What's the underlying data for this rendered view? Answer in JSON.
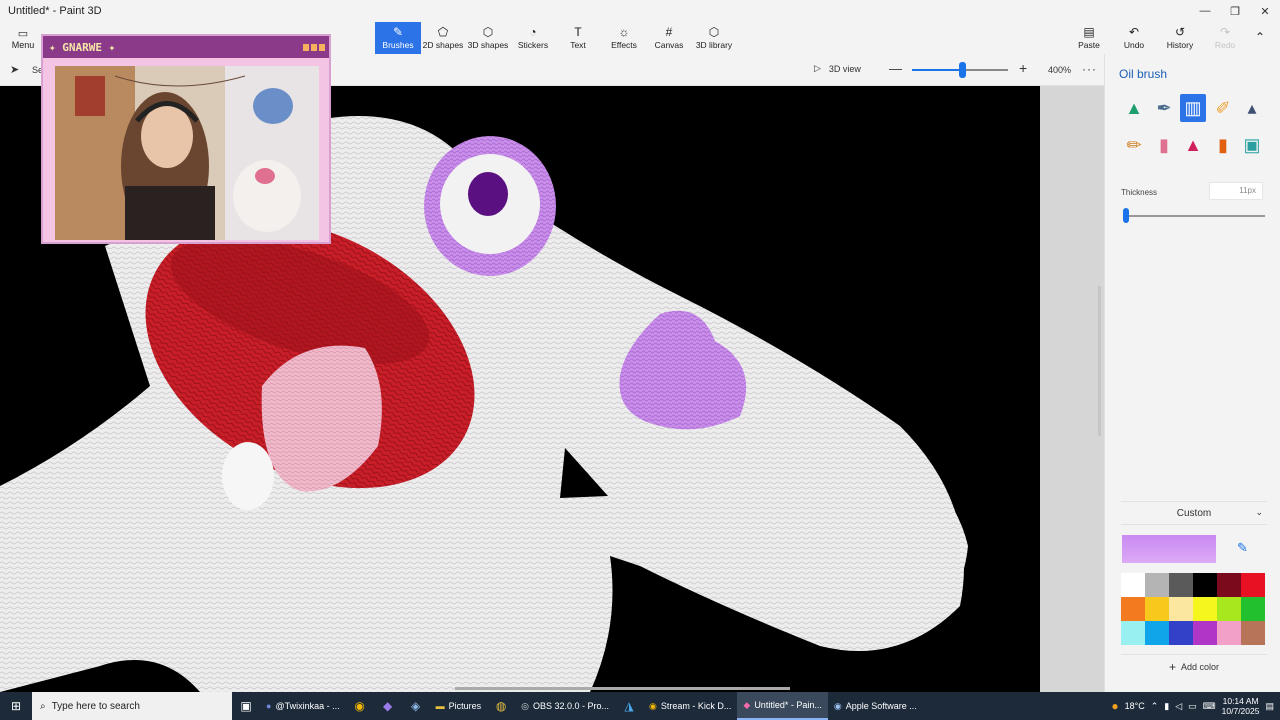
{
  "window": {
    "title": "Untitled* - Paint 3D",
    "minimize_glyph": "—",
    "maximize_glyph": "❐",
    "close_glyph": "✕"
  },
  "ribbon": {
    "menu_label": "Menu",
    "tools": [
      {
        "label": "Brushes",
        "icon": "brush-icon",
        "glyph": "✎",
        "active": true
      },
      {
        "label": "2D shapes",
        "icon": "2d-shapes-icon",
        "glyph": "⬠",
        "active": false
      },
      {
        "label": "3D shapes",
        "icon": "3d-shapes-icon",
        "glyph": "⬡",
        "active": false
      },
      {
        "label": "Stickers",
        "icon": "stickers-icon",
        "glyph": "◔",
        "active": false
      },
      {
        "label": "Text",
        "icon": "text-icon",
        "glyph": "T",
        "active": false
      },
      {
        "label": "Effects",
        "icon": "effects-icon",
        "glyph": "☼",
        "active": false
      },
      {
        "label": "Canvas",
        "icon": "canvas-icon",
        "glyph": "#",
        "active": false
      },
      {
        "label": "3D library",
        "icon": "3d-library-icon",
        "glyph": "⬡",
        "active": false
      }
    ],
    "paste_label": "Paste",
    "undo_label": "Undo",
    "history_label": "History",
    "redo_label": "Redo"
  },
  "subbar": {
    "select_label": "Se",
    "view3d_label": "3D view",
    "zoom_level_percent": 400,
    "zoom_label": "400%",
    "zoom_slider_fraction": 0.52,
    "minus_glyph": "—",
    "plus_glyph": "+",
    "more_glyph": "···"
  },
  "panel": {
    "title": "Oil brush",
    "brushes": [
      {
        "name": "marker-brush-icon",
        "color": "#1f9e6e",
        "selected": false
      },
      {
        "name": "calligraphy-pen-icon",
        "color": "#4a6a8a",
        "selected": false
      },
      {
        "name": "oil-brush-icon",
        "color": "#ffffff",
        "selected": true
      },
      {
        "name": "watercolor-brush-icon",
        "color": "#f0a030",
        "selected": false
      },
      {
        "name": "pixel-pen-icon",
        "color": "#405070",
        "selected": false
      },
      {
        "name": "pencil-icon",
        "color": "#d08020",
        "selected": false
      },
      {
        "name": "eraser-icon",
        "color": "#e07090",
        "selected": false
      },
      {
        "name": "crayon-icon",
        "color": "#d0205a",
        "selected": false
      },
      {
        "name": "spray-can-icon",
        "color": "#e06010",
        "selected": false
      },
      {
        "name": "fill-bucket-icon",
        "color": "#2aa0a0",
        "selected": false
      }
    ],
    "thickness_label": "Thickness",
    "thickness_value": "11px",
    "thickness_fraction": 0.02,
    "color_mode": "Custom",
    "current_color": "#c98af2",
    "swatches": [
      "#ffffff",
      "#b4b4b4",
      "#5a5a5a",
      "#000000",
      "#7a0a1c",
      "#e81123",
      "#f47a20",
      "#f8c81c",
      "#fbe7a0",
      "#f5f61e",
      "#a8e61d",
      "#22c02e",
      "#99f0f0",
      "#10a4e8",
      "#3340c8",
      "#b036c8",
      "#f2a0c8",
      "#b87458"
    ],
    "add_color_label": "Add color"
  },
  "webcam": {
    "name": "✦ GNARWE ✦"
  },
  "taskbar": {
    "search_placeholder": "Type here to search",
    "apps": [
      {
        "label": "@Twixinkaa - ...",
        "icon": "discord-icon",
        "active": false
      },
      {
        "label": "Pictures",
        "icon": "folder-icon",
        "active": false
      },
      {
        "label": "OBS 32.0.0 - Pro...",
        "icon": "obs-icon",
        "active": false
      },
      {
        "label": "Stream - Kick D...",
        "icon": "chrome-icon",
        "active": false
      },
      {
        "label": "Untitled* - Pain...",
        "icon": "paint3d-icon",
        "active": true
      },
      {
        "label": "Apple Software ...",
        "icon": "apple-update-icon",
        "active": false
      }
    ],
    "weather": "18°C",
    "time": "10:14 AM",
    "date": "10/7/2025"
  }
}
